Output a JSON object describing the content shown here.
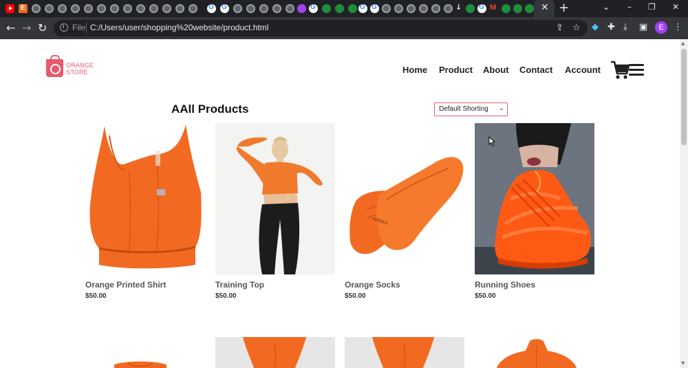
{
  "browser": {
    "tab_close": "✕",
    "new_tab": "+",
    "address": {
      "scheme": "File",
      "url": "C:/Users/user/shopping%20website/product.html"
    },
    "profile_initial": "E",
    "window_controls": [
      "⌄",
      "–",
      "❐",
      "✕"
    ]
  },
  "site": {
    "logo": {
      "line1": "ORANGE",
      "line2": "STORE"
    },
    "nav": [
      "Home",
      "Product",
      "About",
      "Contact",
      "Account"
    ],
    "page_title": "AAll Products",
    "sort": {
      "selected": "Default Shorting"
    },
    "accent": "#e85a6e",
    "product_color": "#f26a22"
  },
  "products": [
    {
      "name": "Orange Printed Shirt",
      "price": "$50.00",
      "image": "sports-bra"
    },
    {
      "name": "Training Top",
      "price": "$50.00",
      "image": "model-crop-top"
    },
    {
      "name": "Orange Socks",
      "price": "$50.00",
      "image": "ankle-socks"
    },
    {
      "name": "Running Shoes",
      "price": "$50.00",
      "image": "orange-sneaker"
    }
  ]
}
